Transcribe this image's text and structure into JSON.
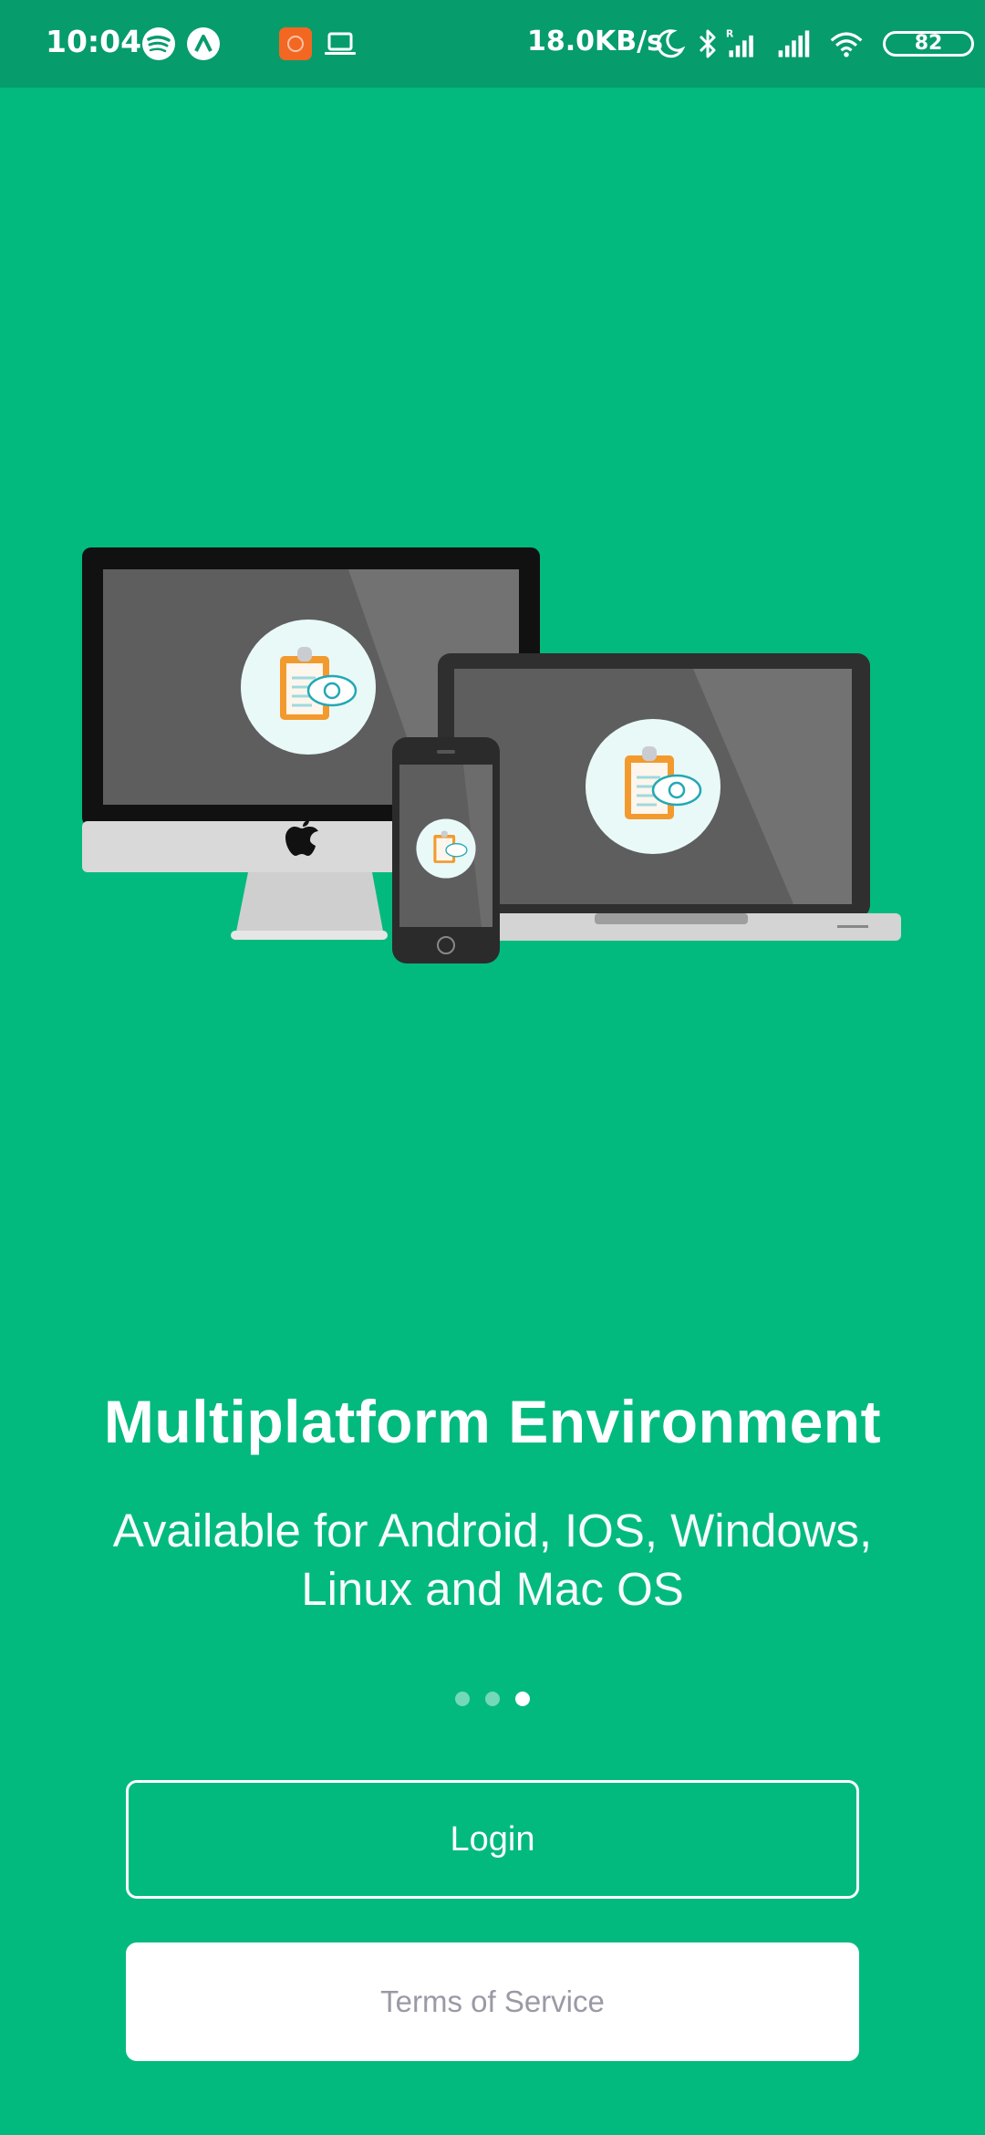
{
  "status_bar": {
    "time": "10:04",
    "network_speed": "18.0KB/s",
    "battery": "82",
    "icons": [
      "spotify-icon",
      "arc-app-icon",
      "recorder-icon",
      "laptop-icon",
      "moon-icon",
      "bluetooth-icon",
      "signal-roaming-icon",
      "signal-icon",
      "wifi-icon"
    ]
  },
  "hero": {
    "illustration": "devices-illustration",
    "app_icon": "clipboard-cloud-sync-icon"
  },
  "onboarding": {
    "title": "Multiplatform Environment",
    "subtitle": "Available for Android, IOS, Windows, Linux and Mac OS",
    "page_count": 3,
    "active_page": 3
  },
  "actions": {
    "login_label": "Login",
    "terms_label": "Terms of Service"
  },
  "colors": {
    "background": "#02BA7E",
    "status_bar": "#069C6C",
    "accent_orange": "#F39A2E"
  }
}
